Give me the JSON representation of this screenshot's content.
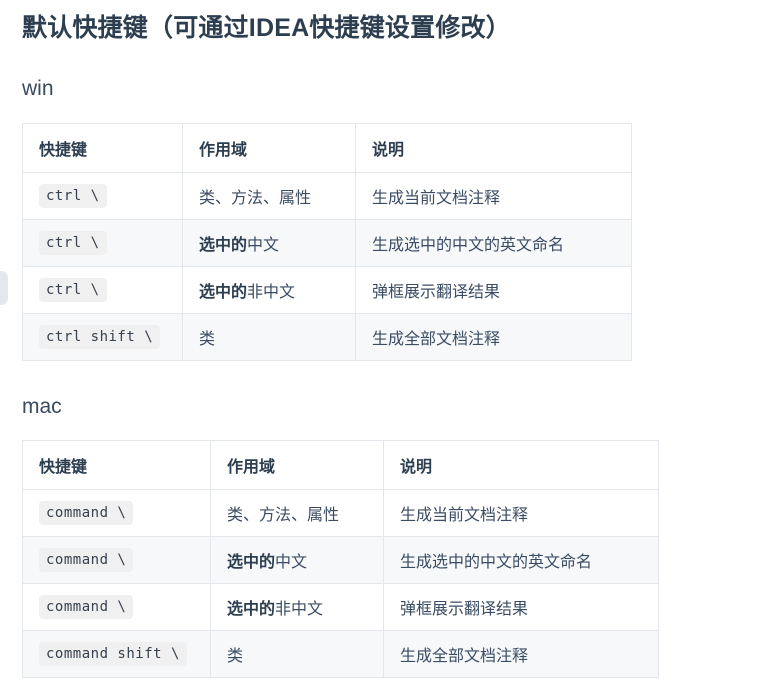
{
  "page": {
    "title": "默认快捷键（可通过IDEA快捷键设置修改）",
    "background_color": "#ffffff",
    "text_color": "#34495e"
  },
  "sections": [
    {
      "heading": "win",
      "table": {
        "columns": [
          "快捷键",
          "作用域",
          "说明"
        ],
        "rows": [
          {
            "shortcut": "ctrl \\",
            "scope_bold": "",
            "scope_rest": "类、方法、属性",
            "description": "生成当前文档注释"
          },
          {
            "shortcut": "ctrl \\",
            "scope_bold": "选中的",
            "scope_rest": "中文",
            "description": "生成选中的中文的英文命名"
          },
          {
            "shortcut": "ctrl \\",
            "scope_bold": "选中的",
            "scope_rest": "非中文",
            "description": "弹框展示翻译结果"
          },
          {
            "shortcut": "ctrl shift \\",
            "scope_bold": "",
            "scope_rest": "类",
            "description": "生成全部文档注释"
          }
        ]
      }
    },
    {
      "heading": "mac",
      "table": {
        "columns": [
          "快捷键",
          "作用域",
          "说明"
        ],
        "rows": [
          {
            "shortcut": "command \\",
            "scope_bold": "",
            "scope_rest": "类、方法、属性",
            "description": "生成当前文档注释"
          },
          {
            "shortcut": "command \\",
            "scope_bold": "选中的",
            "scope_rest": "中文",
            "description": "生成选中的中文的英文命名"
          },
          {
            "shortcut": "command \\",
            "scope_bold": "选中的",
            "scope_rest": "非中文",
            "description": "弹框展示翻译结果"
          },
          {
            "shortcut": "command shift \\",
            "scope_bold": "",
            "scope_rest": "类",
            "description": "生成全部文档注释"
          }
        ]
      }
    }
  ],
  "colors": {
    "heading": "#2c3e50",
    "body_text": "#3b4c63",
    "table_border": "#e3e6ea",
    "row_stripe": "#f6f8fa",
    "code_background": "#f0f0f0",
    "left_panel_sliver": "#e3e8ef"
  }
}
